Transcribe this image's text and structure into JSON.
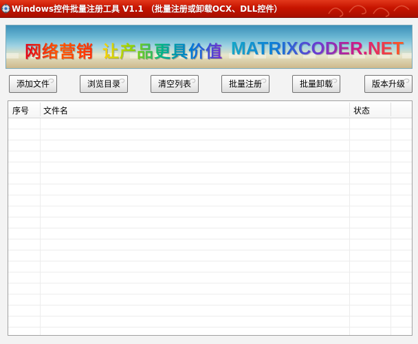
{
  "window": {
    "title": "Windows控件批量注册工具 V1.1 （批量注册或卸载OCX、DLL控件）",
    "icon": "gear-icon",
    "accent_color": "#c71400"
  },
  "banner": {
    "text_1": "网络营销",
    "text_2": "让产品更具价值",
    "text_3": "MATRIXCODER.NET"
  },
  "toolbar": {
    "add_file": "添加文件",
    "browse_dir": "浏览目录",
    "clear_list": "清空列表",
    "batch_register": "批量注册",
    "batch_unregister": "批量卸载",
    "upgrade": "版本升级"
  },
  "list": {
    "columns": [
      "序号",
      "文件名",
      "状态"
    ],
    "rows": []
  }
}
